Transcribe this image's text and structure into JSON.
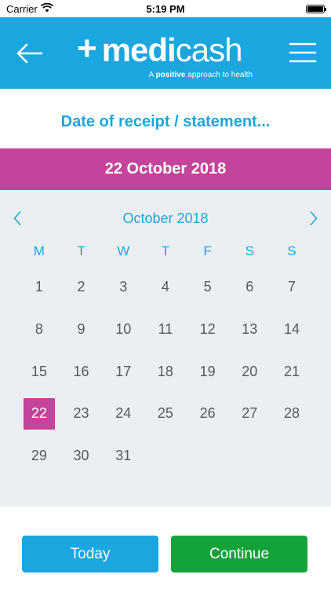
{
  "status_bar": {
    "carrier": "Carrier",
    "time": "5:19 PM",
    "battery_level": 1.0
  },
  "header": {
    "logo_plus": "+",
    "logo_medi": "medi",
    "logo_cash": "cash",
    "tagline_prefix": "A",
    "tagline_bold": "positive",
    "tagline_suffix": "approach to health",
    "back_icon": "arrow-left-icon",
    "menu_icon": "hamburger-menu-icon"
  },
  "page_title": "Date of receipt / statement...",
  "selected_date": "22 October 2018",
  "calendar": {
    "month_label": "October 2018",
    "prev_icon": "chevron-left-icon",
    "next_icon": "chevron-right-icon",
    "weekdays": [
      "M",
      "T",
      "W",
      "T",
      "F",
      "S",
      "S"
    ],
    "days": [
      "1",
      "2",
      "3",
      "4",
      "5",
      "6",
      "7",
      "8",
      "9",
      "10",
      "11",
      "12",
      "13",
      "14",
      "15",
      "16",
      "17",
      "18",
      "19",
      "20",
      "21",
      "22",
      "23",
      "24",
      "25",
      "26",
      "27",
      "28",
      "29",
      "30",
      "31"
    ],
    "selected_day": "22"
  },
  "buttons": {
    "today_label": "Today",
    "continue_label": "Continue"
  },
  "colors": {
    "primary_blue": "#1aa6df",
    "accent_magenta": "#c3449a",
    "continue_green": "#14a33a",
    "calendar_bg": "#eceff2"
  }
}
